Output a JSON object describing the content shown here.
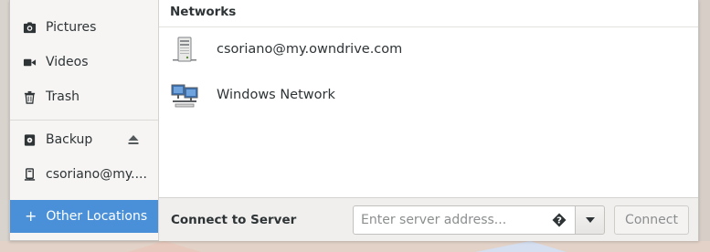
{
  "sidebar": {
    "items": [
      {
        "label": "Pictures",
        "icon": "camera-icon"
      },
      {
        "label": "Videos",
        "icon": "video-icon"
      },
      {
        "label": "Trash",
        "icon": "trash-icon"
      },
      {
        "label": "Backup",
        "icon": "drive-icon"
      },
      {
        "label": "csoriano@my....",
        "icon": "network-drive-icon"
      }
    ],
    "other_locations": "Other Locations"
  },
  "main": {
    "section_title": "Networks",
    "networks": [
      {
        "label": "csoriano@my.owndrive.com",
        "icon": "server-icon"
      },
      {
        "label": "Windows Network",
        "icon": "windows-network-icon"
      }
    ]
  },
  "bottom_bar": {
    "label": "Connect to Server",
    "placeholder": "Enter server address...",
    "connect_label": "Connect"
  },
  "colors": {
    "accent": "#4a90d9",
    "sidebar_bg": "#f6f5f4"
  }
}
